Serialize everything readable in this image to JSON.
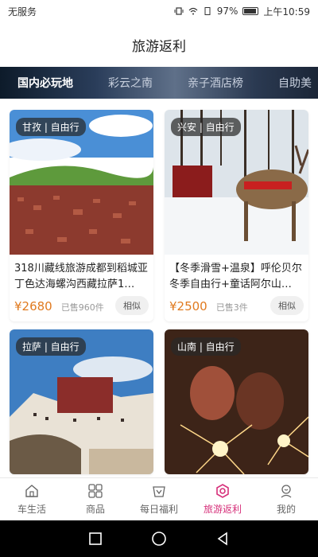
{
  "status": {
    "carrier": "无服务",
    "battery": "97%",
    "time": "上午10:59"
  },
  "header": {
    "title": "旅游返利"
  },
  "tabs": [
    {
      "label": "国内必玩地"
    },
    {
      "label": "彩云之南"
    },
    {
      "label": "亲子酒店榜"
    },
    {
      "label": "自助美"
    }
  ],
  "cards": [
    {
      "tag": "甘孜 | 自由行",
      "title": "318川藏线旅游成都到稻城亚丁色达海螺沟西藏拉萨1…",
      "price": "¥2680",
      "sold": "已售960件",
      "similar": "相似"
    },
    {
      "tag": "兴安 | 自由行",
      "title": "【冬季滑雪+温泉】呼伦贝尔冬季自由行+童话阿尔山…",
      "price": "¥2500",
      "sold": "已售3件",
      "similar": "相似"
    },
    {
      "tag": "拉萨 | 自由行"
    },
    {
      "tag": "山南 | 自由行"
    }
  ],
  "nav": [
    {
      "label": "车生活",
      "icon": "home-icon"
    },
    {
      "label": "商品",
      "icon": "grid-icon"
    },
    {
      "label": "每日福利",
      "icon": "gift-icon"
    },
    {
      "label": "旅游返利",
      "icon": "travel-icon"
    },
    {
      "label": "我的",
      "icon": "profile-icon"
    }
  ],
  "colors": {
    "accent": "#d6307a",
    "price": "#e07a1f"
  }
}
